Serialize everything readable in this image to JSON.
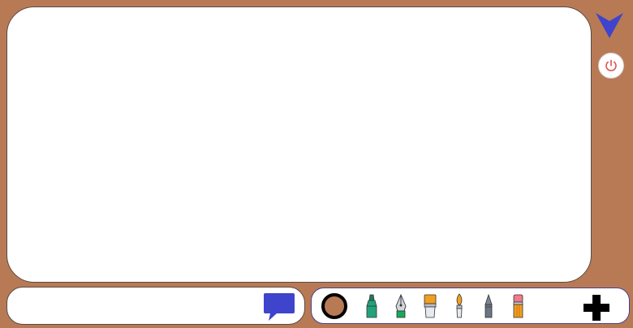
{
  "colors": {
    "background": "#b87a55",
    "accent": "#3f44cc",
    "power": "#e05050",
    "selected_color": "#b87a55"
  },
  "canvas": {},
  "sidebar": {
    "toggle_icon": "chevron-down-arrow-icon",
    "power_icon": "power-icon"
  },
  "chat": {
    "input_value": "",
    "placeholder": "",
    "send_icon": "speech-bubble-icon"
  },
  "toolbar": {
    "color_swatch": "#b87a55",
    "tools": [
      {
        "name": "marker",
        "icon": "marker-icon"
      },
      {
        "name": "fountain-pen",
        "icon": "fountain-pen-icon"
      },
      {
        "name": "flat-brush",
        "icon": "flat-brush-icon"
      },
      {
        "name": "round-brush",
        "icon": "round-brush-icon"
      },
      {
        "name": "pencil",
        "icon": "pencil-icon"
      },
      {
        "name": "eraser",
        "icon": "eraser-icon"
      }
    ],
    "add_icon": "plus-icon"
  }
}
